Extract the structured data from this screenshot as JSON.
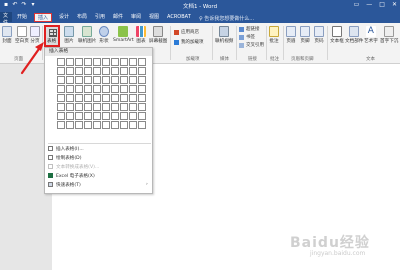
{
  "title_bar": {
    "doc_title": "文档1 - Word",
    "qat_save": "▪",
    "qat_undo": "↶",
    "qat_redo": "↷",
    "qat_more": "▾"
  },
  "window_controls": {
    "restore": "▭",
    "minimize": "—",
    "maximize": "□",
    "close": "✕"
  },
  "tabs": [
    {
      "label": "文件"
    },
    {
      "label": "开始"
    },
    {
      "label": "插入"
    },
    {
      "label": "设计"
    },
    {
      "label": "布局"
    },
    {
      "label": "引用"
    },
    {
      "label": "邮件"
    },
    {
      "label": "审阅"
    },
    {
      "label": "视图"
    },
    {
      "label": "ACROBAT"
    }
  ],
  "tellme": "告诉我您想要做什么...",
  "ribbon": {
    "pages_group": {
      "label": "页面",
      "cover": "封面",
      "blank": "空白页",
      "page_break": "分页"
    },
    "table_button": "表格",
    "illustrations": {
      "picture": "图片",
      "online_picture": "联机图片",
      "shapes": "形状",
      "smartart": "SmartArt",
      "chart": "图表",
      "screenshot": "屏幕截图"
    },
    "addins": {
      "store": "应用商店",
      "my_addins": "我的加载项",
      "label": "加载项"
    },
    "media": {
      "online_video": "联机视频",
      "label": "媒体"
    },
    "links": {
      "hyperlink": "超链接",
      "bookmark": "书签",
      "crossref": "交叉引用",
      "label": "链接"
    },
    "comments": {
      "comment": "批注",
      "label": "批注"
    },
    "header_footer": {
      "header": "页眉",
      "footer": "页脚",
      "page_number": "页码",
      "label": "页眉和页脚"
    },
    "text": {
      "textbox": "文本框",
      "parts": "文档部件",
      "wordart": "艺术字",
      "dropcap": "首字下沉",
      "label": "文本"
    }
  },
  "dropdown": {
    "header": "插入表格",
    "grid_cols": 10,
    "grid_rows": 8,
    "items": [
      {
        "label": "插入表格(I)...",
        "disabled": false,
        "icon": "insert-table-icon"
      },
      {
        "label": "绘制表格(D)",
        "disabled": false,
        "icon": "draw-table-icon"
      },
      {
        "label": "文本转换成表格(V)...",
        "disabled": true,
        "icon": "convert-text-icon"
      },
      {
        "label": "Excel 电子表格(X)",
        "disabled": false,
        "icon": "excel-icon"
      },
      {
        "label": "快速表格(T)",
        "disabled": false,
        "icon": "quick-table-icon"
      }
    ]
  },
  "watermark": {
    "main": "Baidu经验",
    "sub": "jingyan.baidu.com"
  },
  "colors": {
    "word_blue": "#2b579a",
    "highlight_red": "#e02020"
  }
}
